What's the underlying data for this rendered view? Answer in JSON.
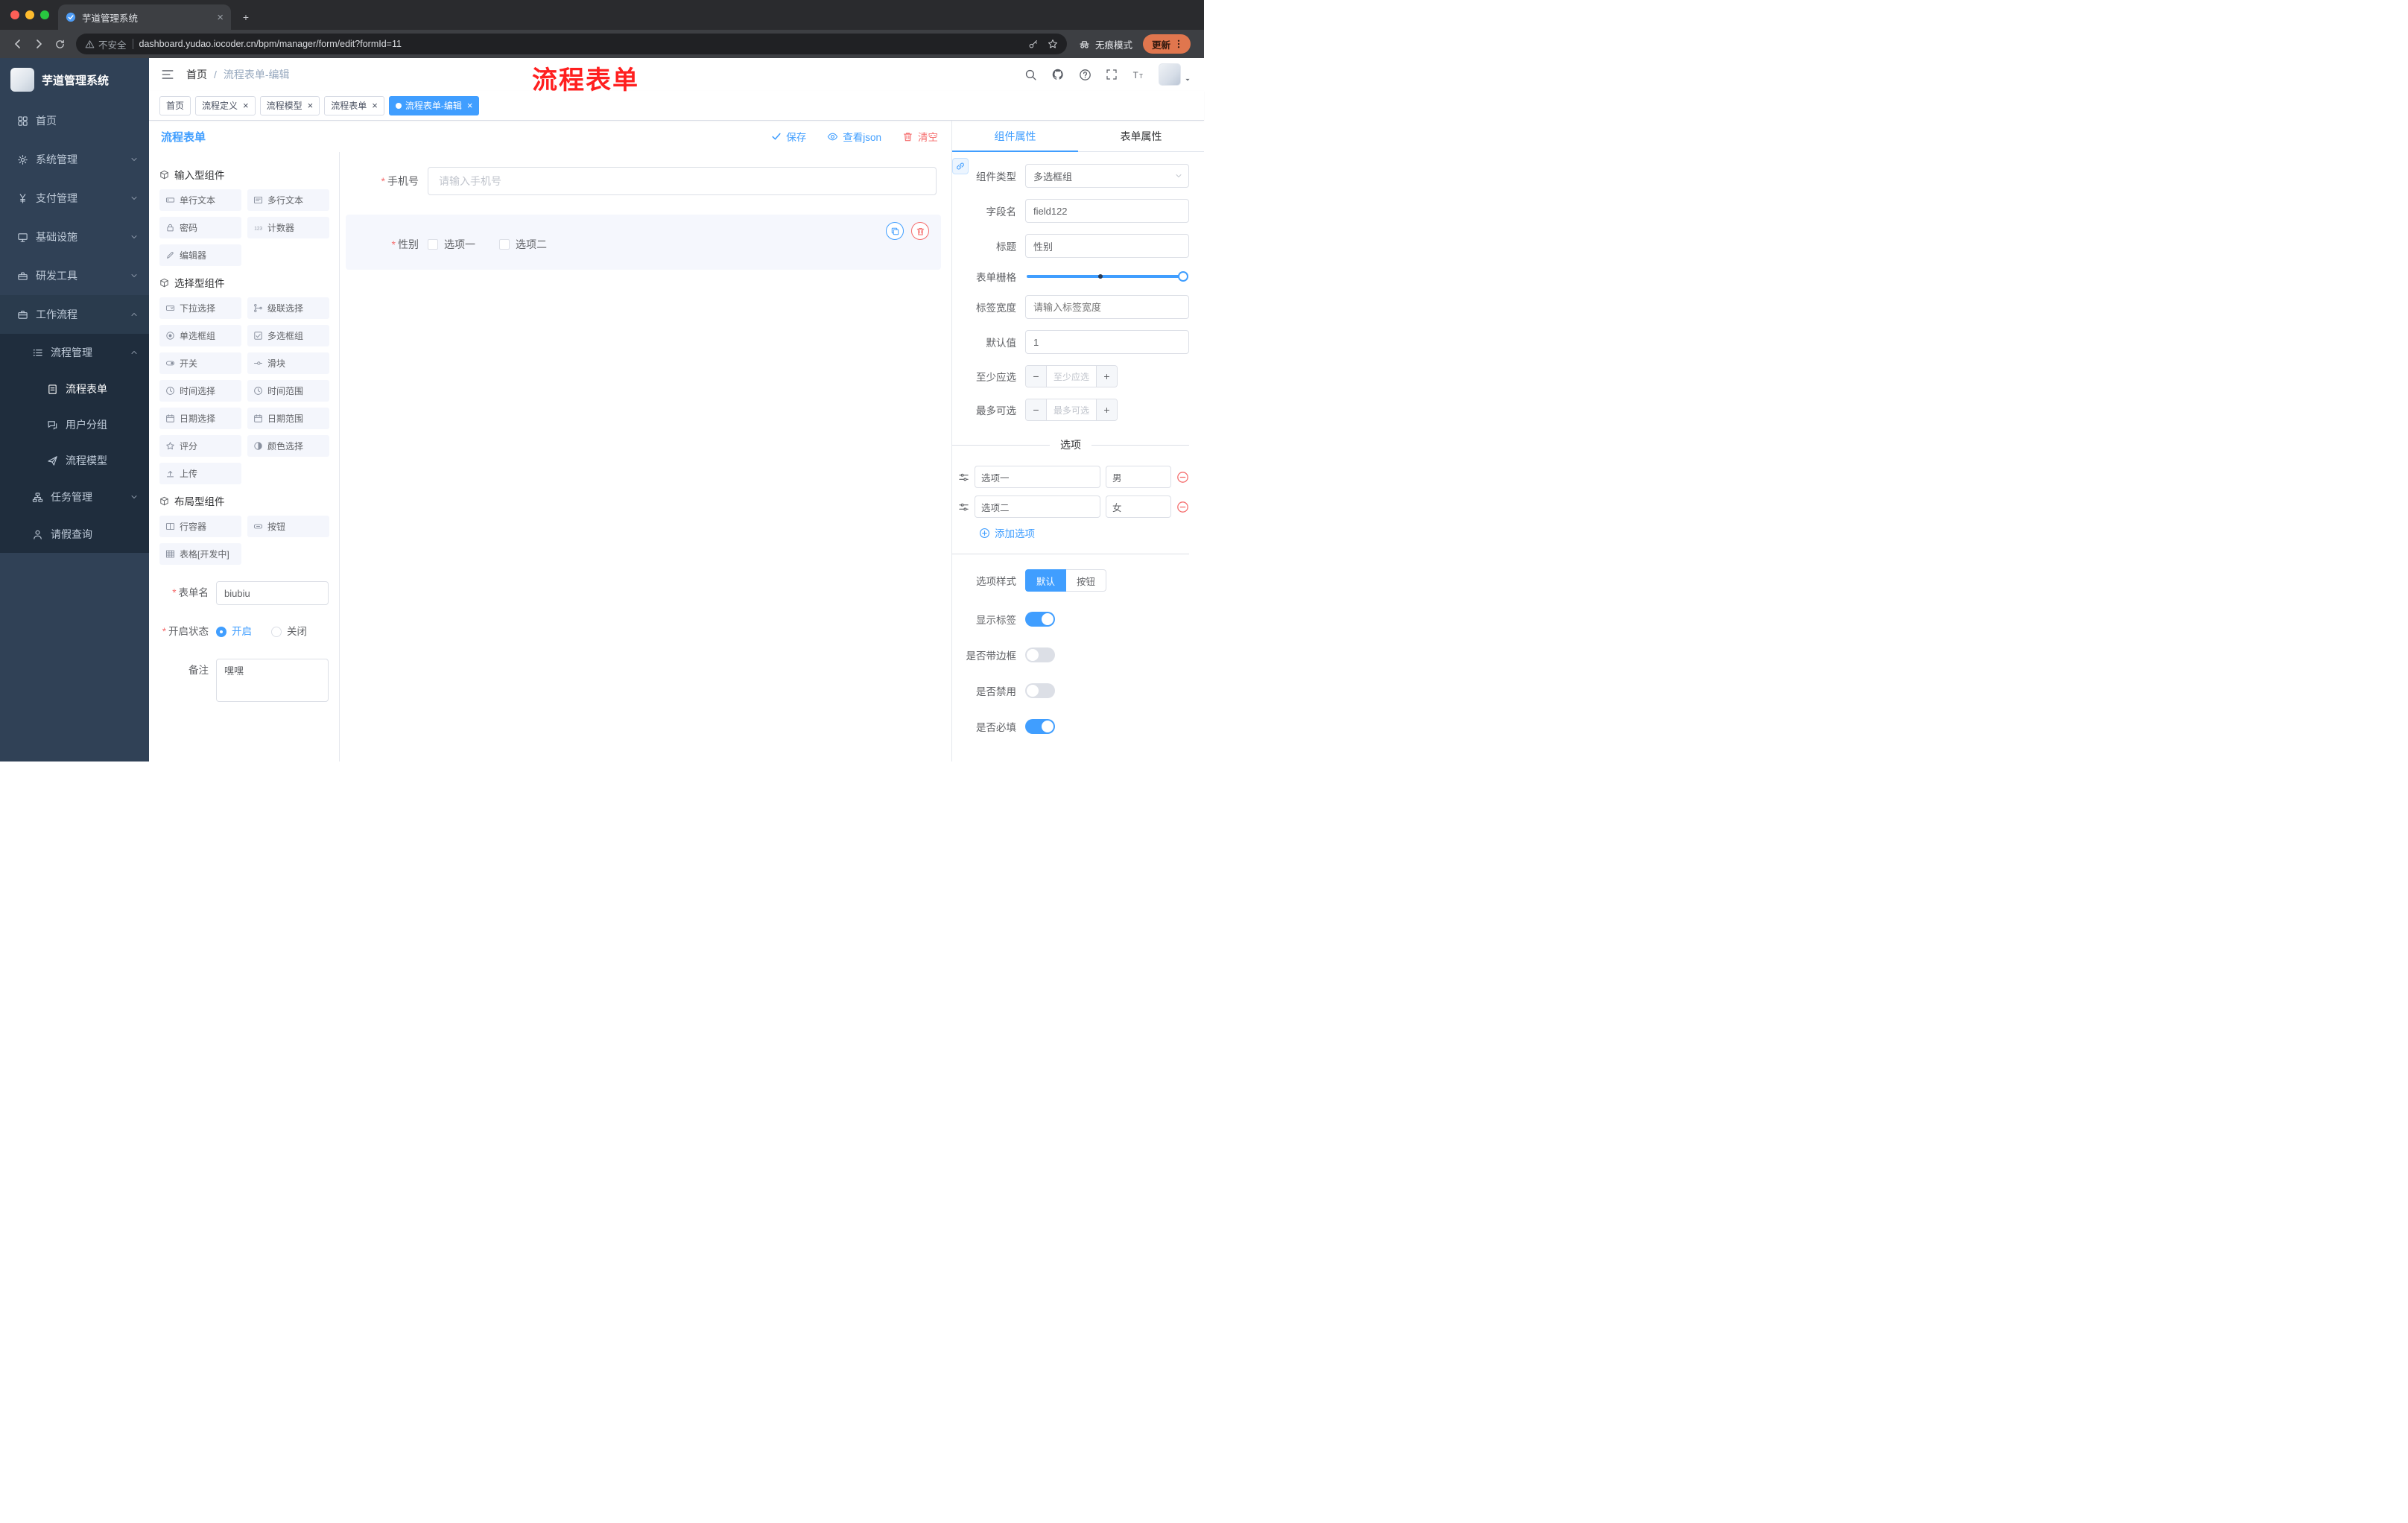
{
  "colors": {
    "accent": "#409eff",
    "danger": "#f56c6c",
    "sidebar_bg": "#304156",
    "submenu_bg": "#1f2d3d",
    "tag_active": "#409eff",
    "chrome_bg": "#3d3f43",
    "update_pill": "#e0764e"
  },
  "browser": {
    "tab_title": "芋道管理系统",
    "security_label": "不安全",
    "url": "dashboard.yudao.iocoder.cn/bpm/manager/form/edit?formId=11",
    "incognito_label": "无痕模式",
    "update_label": "更新"
  },
  "sidebar": {
    "logo_title": "芋道管理系统",
    "items": [
      {
        "label": "首页",
        "icon": "dashboard-icon",
        "level": 1
      },
      {
        "label": "系统管理",
        "icon": "gear-icon",
        "level": 1,
        "chevron": "down"
      },
      {
        "label": "支付管理",
        "icon": "yen-icon",
        "level": 1,
        "chevron": "down"
      },
      {
        "label": "基础设施",
        "icon": "monitor-icon",
        "level": 1,
        "chevron": "down"
      },
      {
        "label": "研发工具",
        "icon": "toolbox-icon",
        "level": 1,
        "chevron": "down"
      },
      {
        "label": "工作流程",
        "icon": "briefcase-icon",
        "level": 1,
        "chevron": "up",
        "bg": "mid"
      },
      {
        "label": "流程管理",
        "icon": "list-icon",
        "level": 2,
        "chevron": "up",
        "bg": "dark"
      },
      {
        "label": "流程表单",
        "icon": "document-icon",
        "level": 3,
        "active": true,
        "bg": "dark"
      },
      {
        "label": "用户分组",
        "icon": "chat-icon",
        "level": 3,
        "bg": "dark"
      },
      {
        "label": "流程模型",
        "icon": "send-icon",
        "level": 3,
        "bg": "dark"
      },
      {
        "label": "任务管理",
        "icon": "tree-icon",
        "level": 2,
        "chevron": "down",
        "bg": "dark"
      },
      {
        "label": "请假查询",
        "icon": "user-icon",
        "level": 2,
        "bg": "dark"
      }
    ]
  },
  "navbar": {
    "breadcrumb": [
      "首页",
      "流程表单-编辑"
    ],
    "breadcrumb_separator": "/",
    "overlay_title": "流程表单"
  },
  "tags": [
    {
      "label": "首页",
      "closable": false,
      "active": false
    },
    {
      "label": "流程定义",
      "closable": true,
      "active": false
    },
    {
      "label": "流程模型",
      "closable": true,
      "active": false
    },
    {
      "label": "流程表单",
      "closable": true,
      "active": false
    },
    {
      "label": "流程表单-编辑",
      "closable": true,
      "active": true
    }
  ],
  "designer": {
    "title": "流程表单",
    "actions": {
      "save": "保存",
      "view_json": "查看json",
      "clear": "清空"
    },
    "groups": [
      {
        "title": "输入型组件",
        "items": [
          {
            "label": "单行文本",
            "icon": "text-input-icon"
          },
          {
            "label": "多行文本",
            "icon": "textarea-icon"
          },
          {
            "label": "密码",
            "icon": "password-icon"
          },
          {
            "label": "计数器",
            "icon": "counter-icon"
          },
          {
            "label": "编辑器",
            "icon": "editor-icon"
          }
        ]
      },
      {
        "title": "选择型组件",
        "items": [
          {
            "label": "下拉选择",
            "icon": "select-icon"
          },
          {
            "label": "级联选择",
            "icon": "cascader-icon"
          },
          {
            "label": "单选框组",
            "icon": "radio-icon"
          },
          {
            "label": "多选框组",
            "icon": "checkbox-icon"
          },
          {
            "label": "开关",
            "icon": "switch-icon"
          },
          {
            "label": "滑块",
            "icon": "slider-icon"
          },
          {
            "label": "时间选择",
            "icon": "time-icon"
          },
          {
            "label": "时间范围",
            "icon": "time-range-icon"
          },
          {
            "label": "日期选择",
            "icon": "date-icon"
          },
          {
            "label": "日期范围",
            "icon": "date-range-icon"
          },
          {
            "label": "评分",
            "icon": "rate-icon"
          },
          {
            "label": "颜色选择",
            "icon": "color-icon"
          },
          {
            "label": "上传",
            "icon": "upload-icon"
          }
        ]
      },
      {
        "title": "布局型组件",
        "items": [
          {
            "label": "行容器",
            "icon": "row-icon"
          },
          {
            "label": "按钮",
            "icon": "button-icon"
          },
          {
            "label": "表格[开发中]",
            "icon": "table-icon"
          }
        ]
      }
    ],
    "meta": {
      "name_label": "表单名",
      "name_value": "biubiu",
      "status_label": "开启状态",
      "status_options": [
        {
          "label": "开启",
          "selected": true
        },
        {
          "label": "关闭",
          "selected": false
        }
      ],
      "remark_label": "备注",
      "remark_value": "嘿嘿"
    },
    "canvas": {
      "phone_label": "手机号",
      "phone_placeholder": "请输入手机号",
      "gender_label": "性别",
      "gender_options": [
        "选项一",
        "选项二"
      ]
    }
  },
  "props": {
    "tabs": [
      {
        "label": "组件属性",
        "active": true
      },
      {
        "label": "表单属性",
        "active": false
      }
    ],
    "component_type_label": "组件类型",
    "component_type_value": "多选框组",
    "field_name_label": "字段名",
    "field_name_value": "field122",
    "title_label": "标题",
    "title_value": "性别",
    "grid_label": "表单栅格",
    "label_width_label": "标签宽度",
    "label_width_placeholder": "请输入标签宽度",
    "default_label": "默认值",
    "default_value": "1",
    "min_label": "至少应选",
    "min_placeholder": "至少应选",
    "max_label": "最多可选",
    "max_placeholder": "最多可选",
    "options_title": "选项",
    "options": [
      {
        "label": "选项一",
        "value": "男"
      },
      {
        "label": "选项二",
        "value": "女"
      }
    ],
    "add_option": "添加选项",
    "style_label": "选项样式",
    "style_options": [
      {
        "label": "默认",
        "active": true
      },
      {
        "label": "按钮",
        "active": false
      }
    ],
    "switches": [
      {
        "label": "显示标签",
        "on": true
      },
      {
        "label": "是否带边框",
        "on": false
      },
      {
        "label": "是否禁用",
        "on": false
      },
      {
        "label": "是否必填",
        "on": true
      }
    ]
  }
}
